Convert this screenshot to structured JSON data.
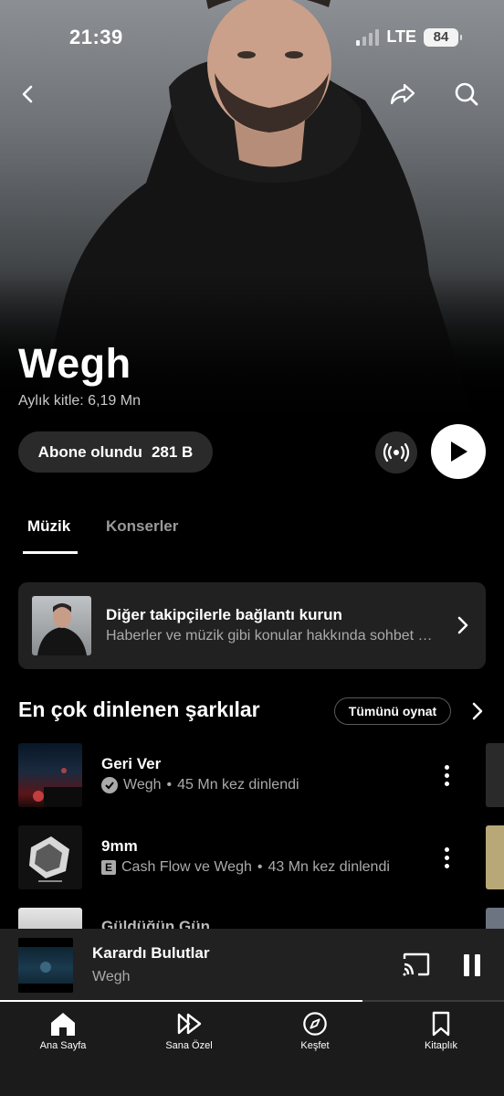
{
  "status": {
    "time": "21:39",
    "network": "LTE",
    "battery": "84"
  },
  "artist": {
    "name": "Wegh",
    "monthly_listeners": "Aylık kitle: 6,19 Mn"
  },
  "actions": {
    "subscribe_label": "Abone olundu",
    "subscriber_count": "281 B"
  },
  "tabs": [
    {
      "label": "Müzik",
      "active": true
    },
    {
      "label": "Konserler",
      "active": false
    }
  ],
  "connect_card": {
    "title": "Diğer takipçilerle bağlantı kurun",
    "subtitle": "Haberler ve müzik gibi konular hakkında sohbet edin"
  },
  "top_songs": {
    "title": "En çok dinlenen şarkılar",
    "play_all_label": "Tümünü oynat",
    "songs": [
      {
        "title": "Geri Ver",
        "artist": "Wegh",
        "plays": "45 Mn kez dinlendi",
        "badge": "verified"
      },
      {
        "title": "9mm",
        "artist": "Cash Flow ve Wegh",
        "plays": "43 Mn kez dinlendi",
        "badge": "explicit"
      },
      {
        "title": "Güldüğün Gün"
      }
    ]
  },
  "now_playing": {
    "title": "Karardı Bulutlar",
    "artist": "Wegh",
    "progress": 0.72
  },
  "bottom_nav": [
    {
      "label": "Ana Sayfa",
      "icon": "home-icon"
    },
    {
      "label": "Sana Özel",
      "icon": "samples-icon"
    },
    {
      "label": "Keşfet",
      "icon": "compass-icon"
    },
    {
      "label": "Kitaplık",
      "icon": "bookmark-icon"
    }
  ],
  "colors": {
    "background": "#000000",
    "surface": "#212121",
    "muted_text": "#aaaaaa"
  }
}
